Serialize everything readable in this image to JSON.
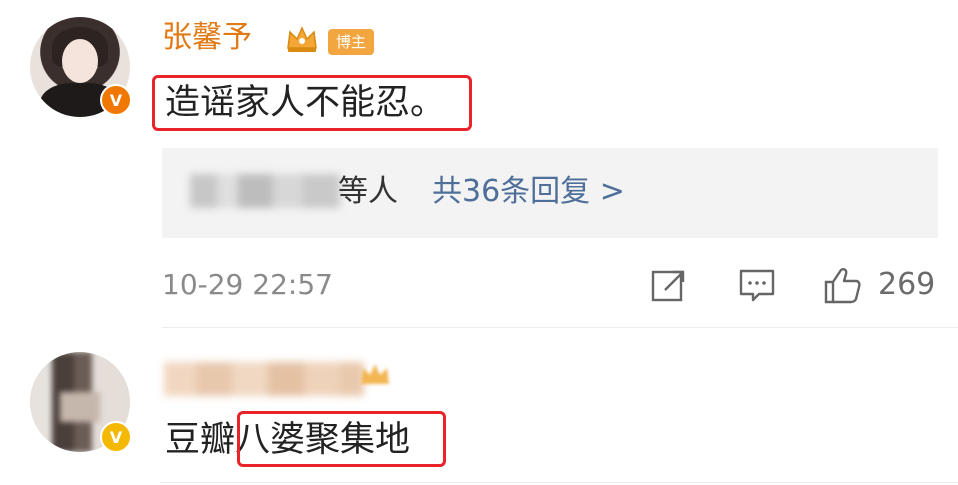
{
  "comments": [
    {
      "author": "张馨予",
      "role_badge": "博主",
      "text": "造谣家人不能忍。",
      "reply_prefix": "等人",
      "reply_link": "共36条回复 >",
      "timestamp": "10-29 22:57",
      "likes": "269",
      "verified_badge": "V"
    },
    {
      "author": "",
      "text_prefix": "豆瓣",
      "text_highlight": "八婆聚集地",
      "verified_badge": "V"
    }
  ],
  "colors": {
    "author_name": "#e07a15",
    "role_badge_bg": "#f3a640",
    "highlight_border": "#e8232a",
    "reply_link": "#4e6f9a",
    "reply_box_bg": "#f3f3f3",
    "timestamp": "#8a8a8a"
  },
  "icons": [
    "crown-icon",
    "share-icon",
    "comment-icon",
    "like-icon",
    "verified-icon"
  ]
}
